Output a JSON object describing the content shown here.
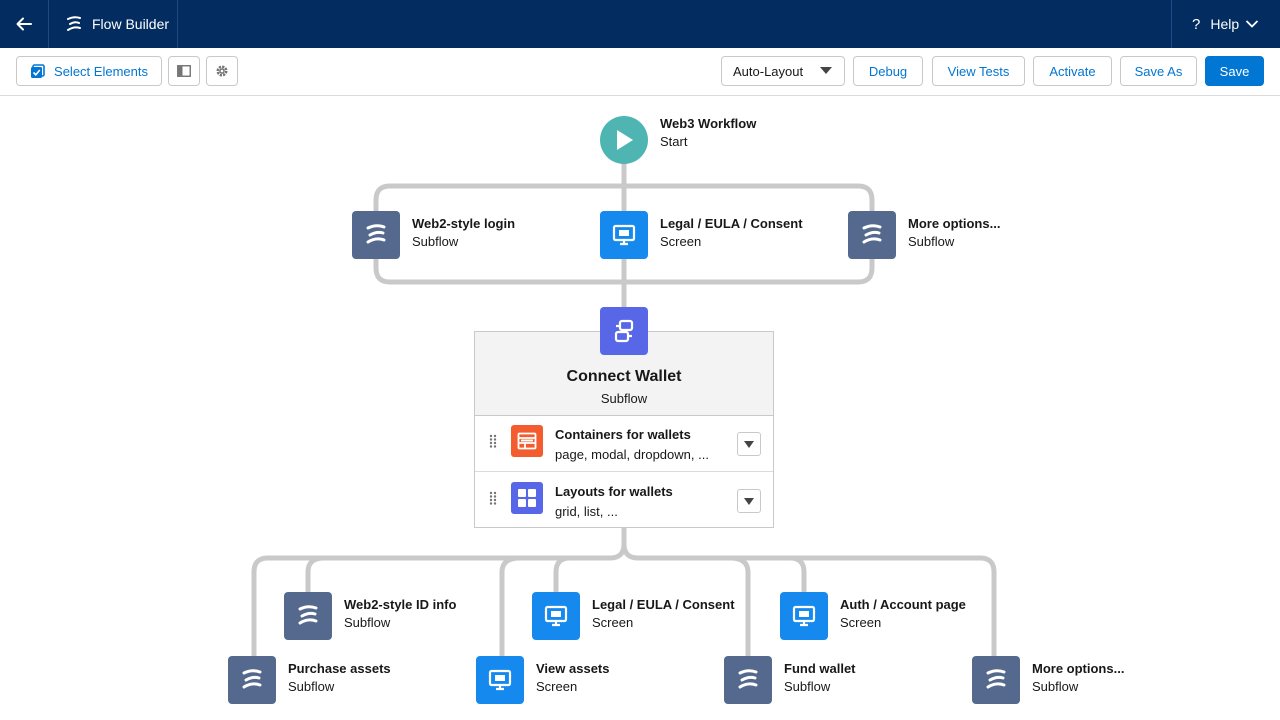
{
  "header": {
    "app_name": "Flow Builder",
    "help_label": "Help"
  },
  "toolbar": {
    "select_elements": "Select Elements",
    "layout_mode": "Auto-Layout",
    "debug": "Debug",
    "view_tests": "View Tests",
    "activate": "Activate",
    "save_as": "Save As",
    "save": "Save"
  },
  "canvas": {
    "start": {
      "title": "Web3 Workflow",
      "subtitle": "Start"
    },
    "branch1": [
      {
        "title": "Web2-style login",
        "subtitle": "Subflow",
        "type": "subflow"
      },
      {
        "title": "Legal / EULA / Consent",
        "subtitle": "Screen",
        "type": "screen"
      },
      {
        "title": "More options...",
        "subtitle": "Subflow",
        "type": "subflow"
      }
    ],
    "connect_wallet": {
      "title": "Connect Wallet",
      "subtitle": "Subflow",
      "items": [
        {
          "title": "Containers for wallets",
          "subtitle": "page, modal, dropdown, ...",
          "icon": "layout-icon",
          "color": "#f25c2e"
        },
        {
          "title": "Layouts for wallets",
          "subtitle": "grid, list, ...",
          "icon": "grid-icon",
          "color": "#5867e8"
        }
      ]
    },
    "branch2_upper": [
      {
        "title": "Web2-style ID info",
        "subtitle": "Subflow",
        "type": "subflow"
      },
      {
        "title": "Legal / EULA / Consent",
        "subtitle": "Screen",
        "type": "screen"
      },
      {
        "title": "Auth / Account page",
        "subtitle": "Screen",
        "type": "screen"
      }
    ],
    "branch2_lower": [
      {
        "title": "Purchase assets",
        "subtitle": "Subflow",
        "type": "subflow"
      },
      {
        "title": "View assets",
        "subtitle": "Screen",
        "type": "screen"
      },
      {
        "title": "Fund wallet",
        "subtitle": "Subflow",
        "type": "subflow"
      },
      {
        "title": "More options...",
        "subtitle": "Subflow",
        "type": "subflow"
      }
    ]
  },
  "colors": {
    "header_bg": "#032d60",
    "brand_blue": "#0176d3",
    "start_teal": "#4fb5b3",
    "subflow_tile": "#54698d",
    "screen_tile": "#1589ee",
    "orchestration_tile": "#5867e8",
    "connector": "#c9c9c9"
  }
}
